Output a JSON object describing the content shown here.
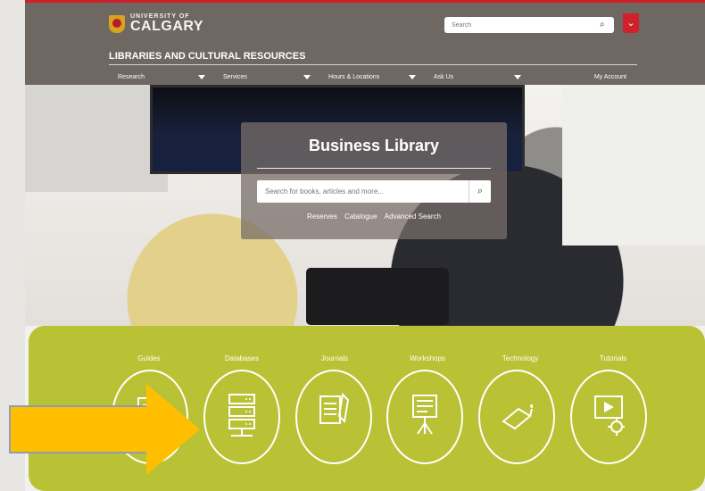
{
  "top": {
    "brand_top": "UNIVERSITY OF",
    "brand_bottom": "CALGARY",
    "search_placeholder": "Search",
    "section_title": "LIBRARIES AND CULTURAL RESOURCES",
    "nav": [
      "Research",
      "Services",
      "Hours & Locations",
      "Ask Us",
      "",
      "My Account"
    ]
  },
  "hero": {
    "title": "Business Library",
    "search_placeholder": "Search for books, articles and more...",
    "links": [
      "Reserves",
      "Catalogue",
      "Advanced Search"
    ]
  },
  "categories": [
    {
      "label": "Guides",
      "icon": "guide-icon"
    },
    {
      "label": "Databases",
      "icon": "database-icon"
    },
    {
      "label": "Journals",
      "icon": "journal-icon"
    },
    {
      "label": "Workshops",
      "icon": "workshop-icon"
    },
    {
      "label": "Technology",
      "icon": "technology-icon"
    },
    {
      "label": "Tutorials",
      "icon": "tutorial-icon"
    }
  ],
  "colors": {
    "header_bg": "#6f6761",
    "accent_red": "#d0202a",
    "green_panel": "#b8c234",
    "arrow": "#ffbf00"
  }
}
